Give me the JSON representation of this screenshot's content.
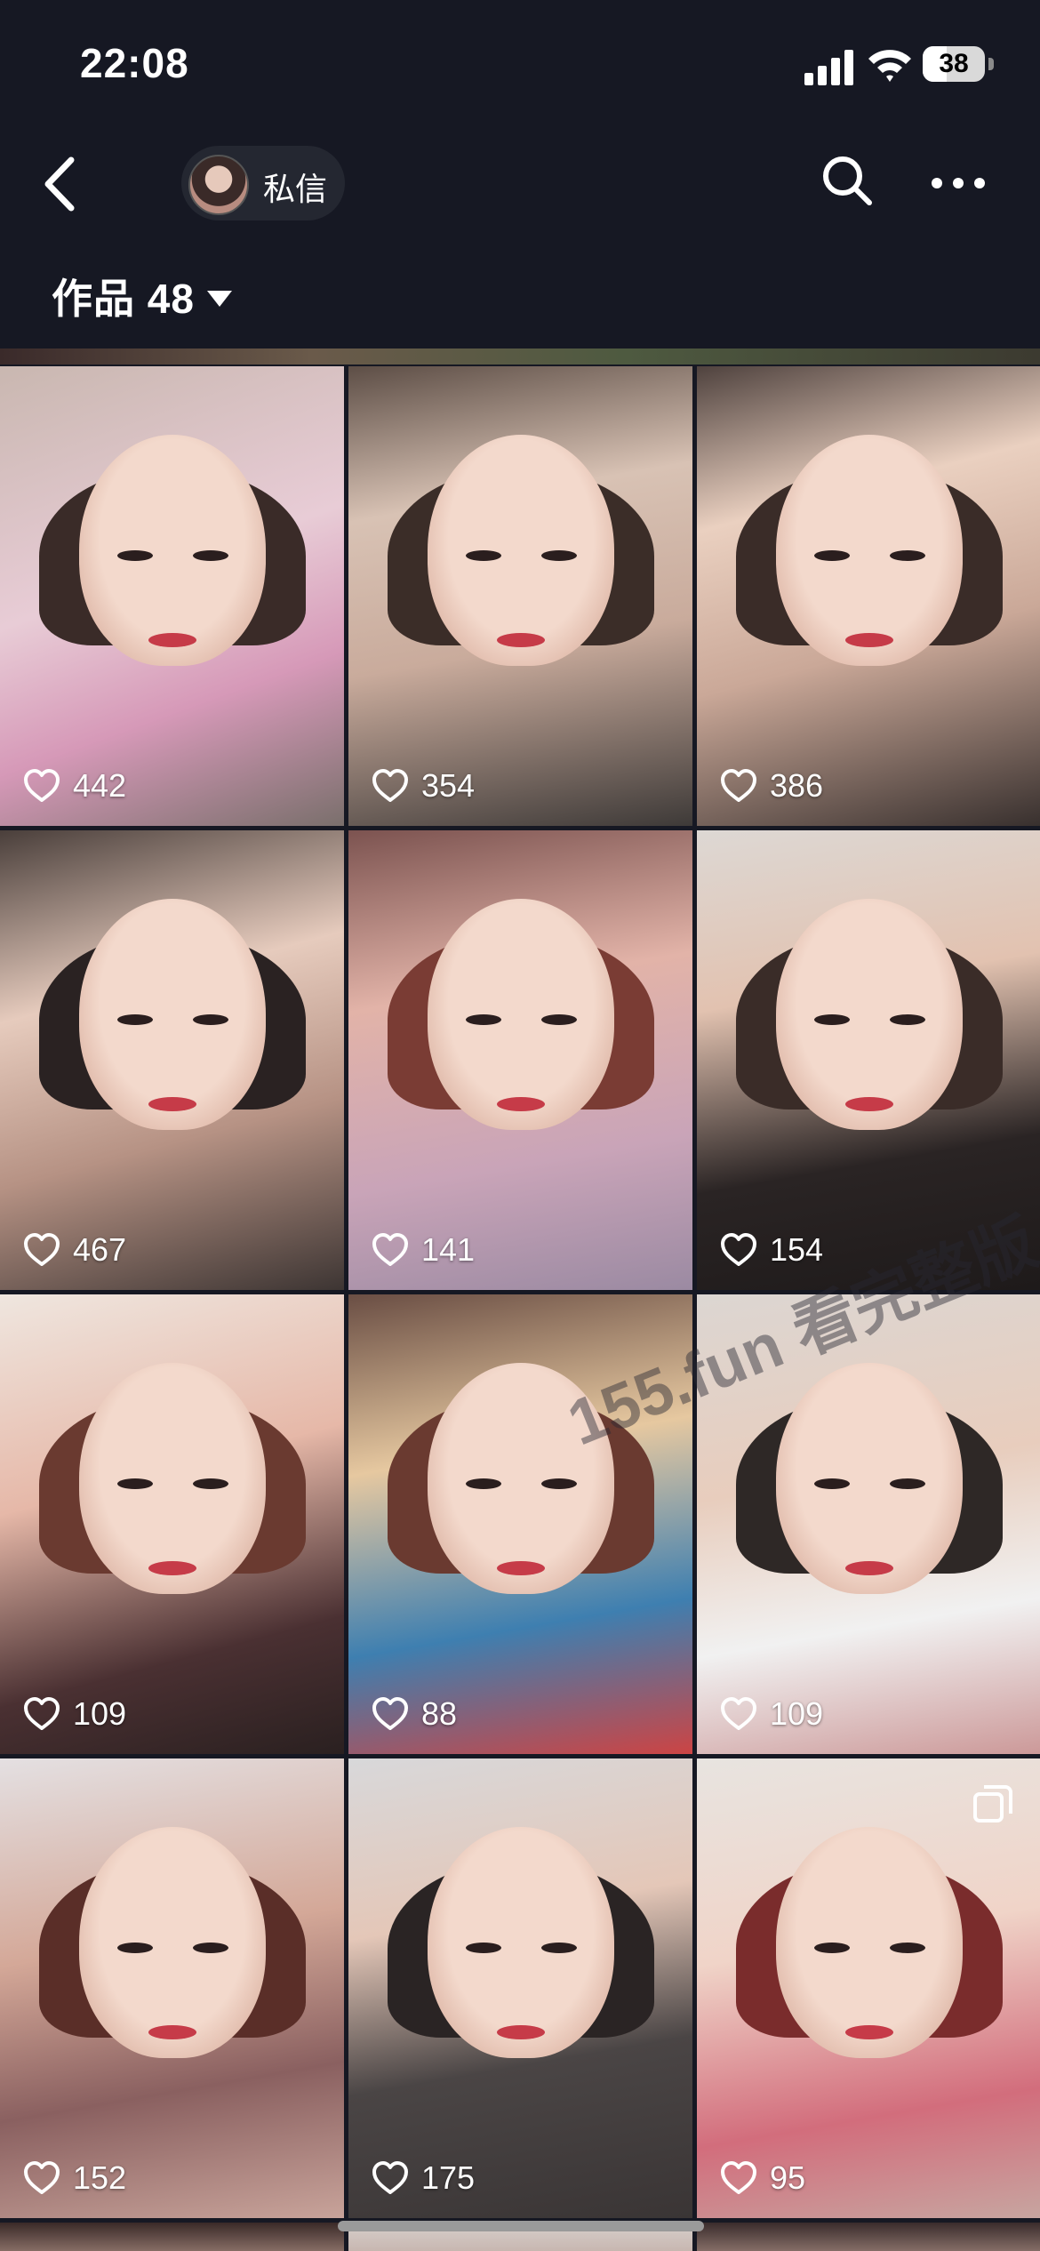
{
  "status_bar": {
    "time": "22:08",
    "battery": "38"
  },
  "nav": {
    "dm_label": "私信"
  },
  "tab": {
    "label": "作品 48"
  },
  "tiles": [
    {
      "likes": "442",
      "multi": false
    },
    {
      "likes": "354",
      "multi": false
    },
    {
      "likes": "386",
      "multi": false
    },
    {
      "likes": "467",
      "multi": false
    },
    {
      "likes": "141",
      "multi": false
    },
    {
      "likes": "154",
      "multi": false
    },
    {
      "likes": "109",
      "multi": false
    },
    {
      "likes": "88",
      "multi": false
    },
    {
      "likes": "109",
      "multi": false
    },
    {
      "likes": "152",
      "multi": false
    },
    {
      "likes": "175",
      "multi": false
    },
    {
      "likes": "95",
      "multi": true
    }
  ],
  "watermark": "155.fun 看完整版",
  "colors": {
    "background": "#161823",
    "pill": "#242731",
    "text": "#ffffff"
  }
}
